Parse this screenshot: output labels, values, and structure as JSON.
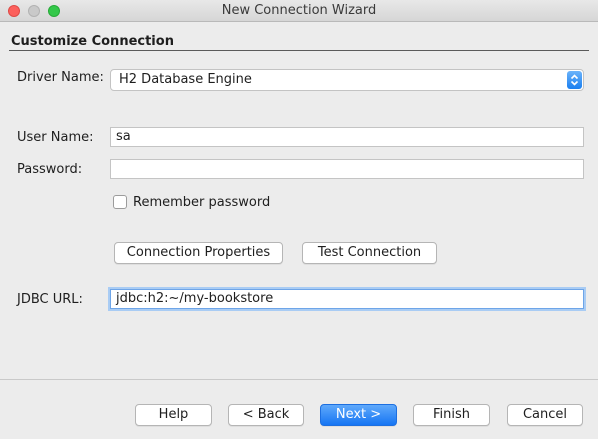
{
  "window": {
    "title": "New Connection Wizard"
  },
  "section": {
    "title": "Customize Connection"
  },
  "driver": {
    "label": "Driver Name:",
    "value": "H2 Database Engine"
  },
  "user": {
    "label": "User Name:",
    "value": "sa"
  },
  "password": {
    "label": "Password:",
    "value": ""
  },
  "remember": {
    "label": "Remember password",
    "checked": false
  },
  "buttons": {
    "connection_properties": "Connection Properties",
    "test_connection": "Test Connection"
  },
  "jdbc": {
    "label": "JDBC URL:",
    "value": "jdbc:h2:~/my-bookstore"
  },
  "footer": {
    "help": "Help",
    "back": "< Back",
    "next": "Next >",
    "finish": "Finish",
    "cancel": "Cancel"
  },
  "colors": {
    "accent": "#1675f3",
    "close": "#fc605c",
    "maximize": "#34c84a",
    "focus_ring": "#a9ccf4"
  }
}
